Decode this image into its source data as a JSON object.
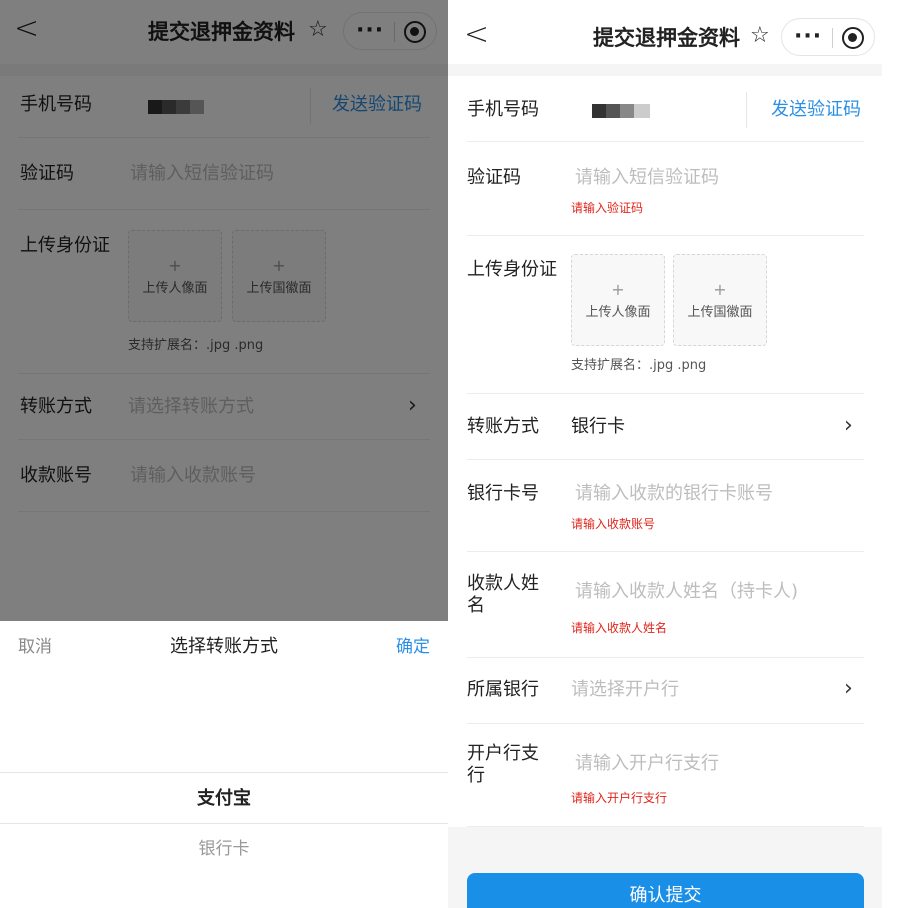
{
  "left": {
    "nav": {
      "back": "<",
      "title": "提交退押金资料",
      "star": "☆",
      "dots": "···"
    },
    "form": {
      "phone_label": "手机号码",
      "send_code": "发送验证码",
      "code_label": "验证码",
      "code_placeholder": "请输入短信验证码",
      "id_label": "上传身份证",
      "upload_front": "上传人像面",
      "upload_back": "上传国徽面",
      "upload_plus": "+",
      "ext_hint": "支持扩展名：.jpg .png",
      "transfer_label": "转账方式",
      "transfer_placeholder": "请选择转账方式",
      "account_label": "收款账号",
      "account_placeholder": "请输入收款账号",
      "chevron": "›"
    },
    "picker": {
      "cancel": "取消",
      "title": "选择转账方式",
      "confirm": "确定",
      "options": [
        "支付宝",
        "银行卡"
      ]
    }
  },
  "right": {
    "nav": {
      "back": "<",
      "title": "提交退押金资料",
      "star": "☆",
      "dots": "···"
    },
    "form": {
      "phone_label": "手机号码",
      "send_code": "发送验证码",
      "code_label": "验证码",
      "code_placeholder": "请输入短信验证码",
      "code_error": "请输入验证码",
      "id_label": "上传身份证",
      "upload_front": "上传人像面",
      "upload_back": "上传国徽面",
      "upload_plus": "+",
      "ext_hint": "支持扩展名：.jpg .png",
      "transfer_label": "转账方式",
      "transfer_value": "银行卡",
      "card_label": "银行卡号",
      "card_placeholder": "请输入收款的银行卡账号",
      "card_error": "请输入收款账号",
      "payee_label_1": "收款人姓",
      "payee_label_2": "名",
      "payee_placeholder": "请输入收款人姓名（持卡人)",
      "payee_error": "请输入收款人姓名",
      "bank_label": "所属银行",
      "bank_placeholder": "请选择开户行",
      "branch_label_1": "开户行支",
      "branch_label_2": "行",
      "branch_placeholder": "请输入开户行支行",
      "branch_error": "请输入开户行支行",
      "chevron": "›"
    },
    "submit": "确认提交"
  },
  "colors": {
    "accent": "#2b8fe6",
    "button": "#1a8fe8",
    "error": "#e0251b",
    "placeholder": "#bdbdbd"
  }
}
